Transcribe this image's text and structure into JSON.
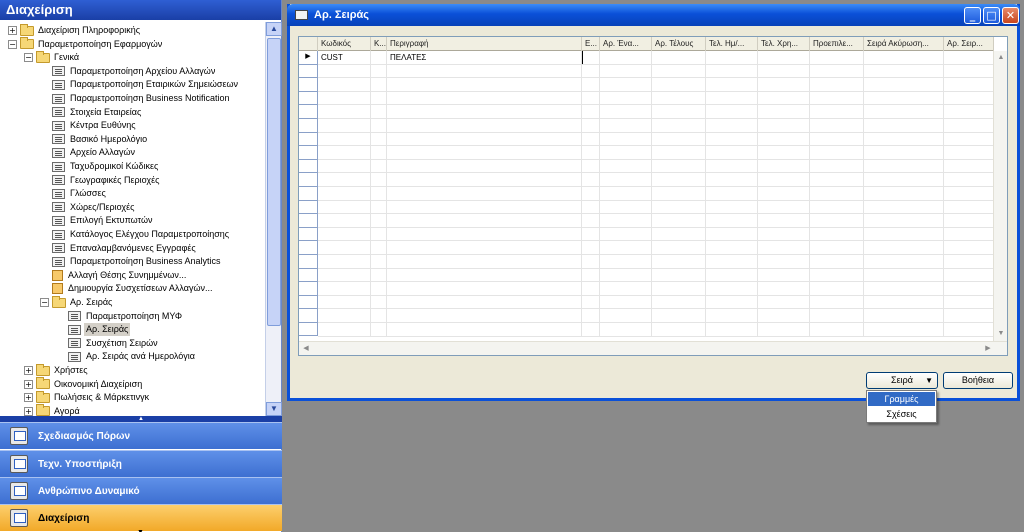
{
  "nav": {
    "title": "Διαχείριση",
    "tree": [
      {
        "label": "Διαχείριση Πληροφορικής",
        "level": 0,
        "type": "folder",
        "expander": "+"
      },
      {
        "label": "Παραμετροποίηση Εφαρμογών",
        "level": 0,
        "type": "folder",
        "expander": "−"
      },
      {
        "label": "Γενικά",
        "level": 1,
        "type": "folder",
        "expander": "−"
      },
      {
        "label": "Παραμετροποίηση Αρχείου Αλλαγών",
        "level": 2,
        "type": "form"
      },
      {
        "label": "Παραμετροποίηση Εταιρικών Σημειώσεων",
        "level": 2,
        "type": "form"
      },
      {
        "label": "Παραμετροποίηση Business Notification",
        "level": 2,
        "type": "form"
      },
      {
        "label": "Στοιχεία Εταιρείας",
        "level": 2,
        "type": "form"
      },
      {
        "label": "Κέντρα Ευθύνης",
        "level": 2,
        "type": "form"
      },
      {
        "label": "Βασικό Ημερολόγιο",
        "level": 2,
        "type": "form"
      },
      {
        "label": "Αρχείο Αλλαγών",
        "level": 2,
        "type": "form"
      },
      {
        "label": "Ταχυδρομικοί Κώδικες",
        "level": 2,
        "type": "form"
      },
      {
        "label": "Γεωγραφικές Περιοχές",
        "level": 2,
        "type": "form"
      },
      {
        "label": "Γλώσσες",
        "level": 2,
        "type": "form"
      },
      {
        "label": "Χώρες/Περιοχές",
        "level": 2,
        "type": "form"
      },
      {
        "label": "Επιλογή Εκτυπωτών",
        "level": 2,
        "type": "form"
      },
      {
        "label": "Κατάλογος Ελέγχου Παραμετροποίησης",
        "level": 2,
        "type": "form"
      },
      {
        "label": "Επαναλαμβανόμενες Εγγραφές",
        "level": 2,
        "type": "form"
      },
      {
        "label": "Παραμετροποίηση Business Analytics",
        "level": 2,
        "type": "form"
      },
      {
        "label": "Αλλαγή Θέσης Συνημμένων...",
        "level": 2,
        "type": "report"
      },
      {
        "label": "Δημιουργία Συσχετίσεων Αλλαγών...",
        "level": 2,
        "type": "report"
      },
      {
        "label": "Αρ. Σειράς",
        "level": 2,
        "type": "folder",
        "expander": "−"
      },
      {
        "label": "Παραμετροποίηση ΜΥΦ",
        "level": 3,
        "type": "form"
      },
      {
        "label": "Αρ. Σειράς",
        "level": 3,
        "type": "form",
        "selected": true
      },
      {
        "label": "Συσχέτιση Σειρών",
        "level": 3,
        "type": "form"
      },
      {
        "label": "Αρ. Σειράς ανά Ημερολόγια",
        "level": 3,
        "type": "form"
      },
      {
        "label": "Χρήστες",
        "level": 1,
        "type": "folder",
        "expander": "+"
      },
      {
        "label": "Οικονομική Διαχείριση",
        "level": 1,
        "type": "folder",
        "expander": "+"
      },
      {
        "label": "Πωλήσεις & Μάρκετινγκ",
        "level": 1,
        "type": "folder",
        "expander": "+"
      },
      {
        "label": "Αγορά",
        "level": 1,
        "type": "folder",
        "expander": "+"
      }
    ],
    "menu_buttons": [
      {
        "label": "Σχεδιασμός Πόρων",
        "icon": "resource-planning-icon",
        "active": false
      },
      {
        "label": "Τεχν. Υποστήριξη",
        "icon": "tech-support-icon",
        "active": false
      },
      {
        "label": "Ανθρώπινο Δυναμικό",
        "icon": "human-resources-icon",
        "active": false
      },
      {
        "label": "Διαχείριση",
        "icon": "administration-icon",
        "active": true
      }
    ]
  },
  "window": {
    "title": "Αρ. Σειράς",
    "columns": [
      "Κωδικός",
      "Κ...",
      "Περιγραφή",
      "Ε...",
      "Αρ. Ένα...",
      "Αρ. Τέλους",
      "Τελ. Ημ/...",
      "Τελ. Χρη...",
      "Προεπιλε...",
      "Σειρά Ακύρωση...",
      "Αρ. Σειρ..."
    ],
    "rows": [
      [
        "CUST",
        "",
        "ΠΕΛΑΤΕΣ",
        "",
        "",
        "",
        "",
        "",
        "",
        "",
        ""
      ]
    ],
    "empty_rows": 20,
    "buttons": {
      "series": "Σειρά",
      "help": "Βοήθεια"
    },
    "popup_menu": [
      "Γραμμές",
      "Σχέσεις"
    ]
  },
  "colors": {
    "title_bar": "#0a50d8",
    "nav_header": "#1a3fa6",
    "active_menu": "#f2a928",
    "popup_highlight": "#316ac5"
  }
}
